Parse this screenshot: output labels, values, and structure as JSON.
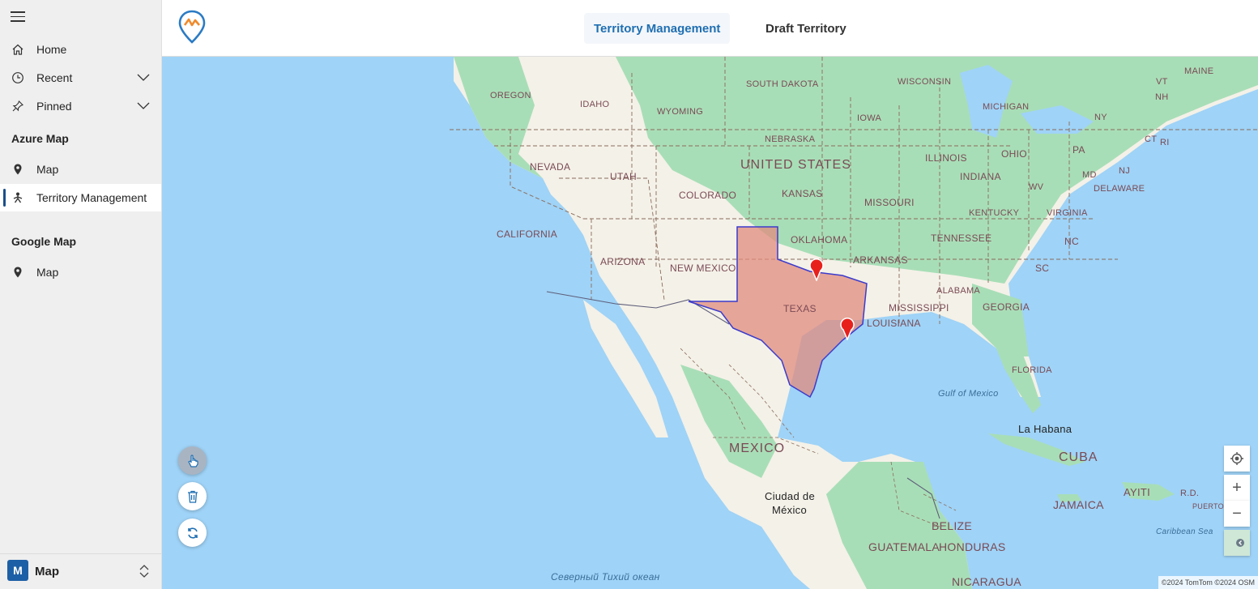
{
  "sidebar": {
    "items": [
      {
        "label": "Home",
        "icon": "home-icon"
      },
      {
        "label": "Recent",
        "icon": "clock-icon"
      },
      {
        "label": "Pinned",
        "icon": "pin-icon"
      }
    ],
    "sections": [
      {
        "title": "Azure Map",
        "items": [
          {
            "label": "Map",
            "icon": "map-marker-icon"
          },
          {
            "label": "Territory Management",
            "icon": "territory-icon",
            "active": true
          }
        ]
      },
      {
        "title": "Google Map",
        "items": [
          {
            "label": "Map",
            "icon": "map-marker-icon"
          }
        ]
      }
    ],
    "bottom": {
      "avatar": "M",
      "label": "Map"
    }
  },
  "header": {
    "tabs": [
      {
        "label": "Territory Management",
        "active": true
      },
      {
        "label": "Draft Territory",
        "active": false
      }
    ]
  },
  "map": {
    "countries": {
      "us": "UNITED STATES",
      "mexico": "MEXICO",
      "cuba": "CUBA"
    },
    "states": {
      "oregon": "OREGON",
      "idaho": "IDAHO",
      "wyoming": "WYOMING",
      "south_dakota": "SOUTH DAKOTA",
      "wisconsin": "WISCONSIN",
      "michigan": "MICHIGAN",
      "maine": "MAINE",
      "vt": "VT",
      "nh": "NH",
      "ny": "NY",
      "ct": "CT",
      "ri": "RI",
      "iowa": "IOWA",
      "nebraska": "NEBRASKA",
      "illinois": "ILLINOIS",
      "ohio": "OHIO",
      "pa": "PA",
      "nj": "NJ",
      "md": "MD",
      "de": "DELAWARE",
      "nevada": "NEVADA",
      "utah": "UTAH",
      "colorado": "COLORADO",
      "kansas": "KANSAS",
      "missouri": "MISSOURI",
      "indiana": "INDIANA",
      "wv": "WV",
      "virginia": "VIRGINIA",
      "kentucky": "KENTUCKY",
      "california": "CALIFORNIA",
      "oklahoma": "OKLAHOMA",
      "tennessee": "TENNESSEE",
      "nc": "NC",
      "arizona": "ARIZONA",
      "new_mexico": "NEW MEXICO",
      "arkansas": "ARKANSAS",
      "sc": "SC",
      "texas": "TEXAS",
      "alabama": "ALABAMA",
      "mississippi": "MISSISSIPPI",
      "georgia": "GEORGIA",
      "louisiana": "LOUISIANA",
      "florida": "FLORIDA"
    },
    "places": {
      "gulf": "Gulf of Mexico",
      "habana": "La Habana",
      "mexico_city_1": "Ciudad de",
      "mexico_city_2": "México",
      "belize": "BELIZE",
      "guatemala": "GUATEMALA",
      "honduras": "HONDURAS",
      "nicaragua": "NICARAGUA",
      "jamaica": "JAMAICA",
      "ayiti": "AYITI",
      "rd": "R.D.",
      "puerto": "PUERTO RI",
      "caribbean": "Caribbean Sea",
      "pacific": "Северный Тихий океан"
    },
    "attribution": "©2024 TomTom  ©2024 OSM",
    "colors": {
      "water": "#9fd3f7",
      "land": "#f4f1e8",
      "vegetation": "#a8deb7",
      "territory_fill": "#e08b7d",
      "territory_border": "#3b3bcc",
      "pin": "#e8201c"
    }
  }
}
